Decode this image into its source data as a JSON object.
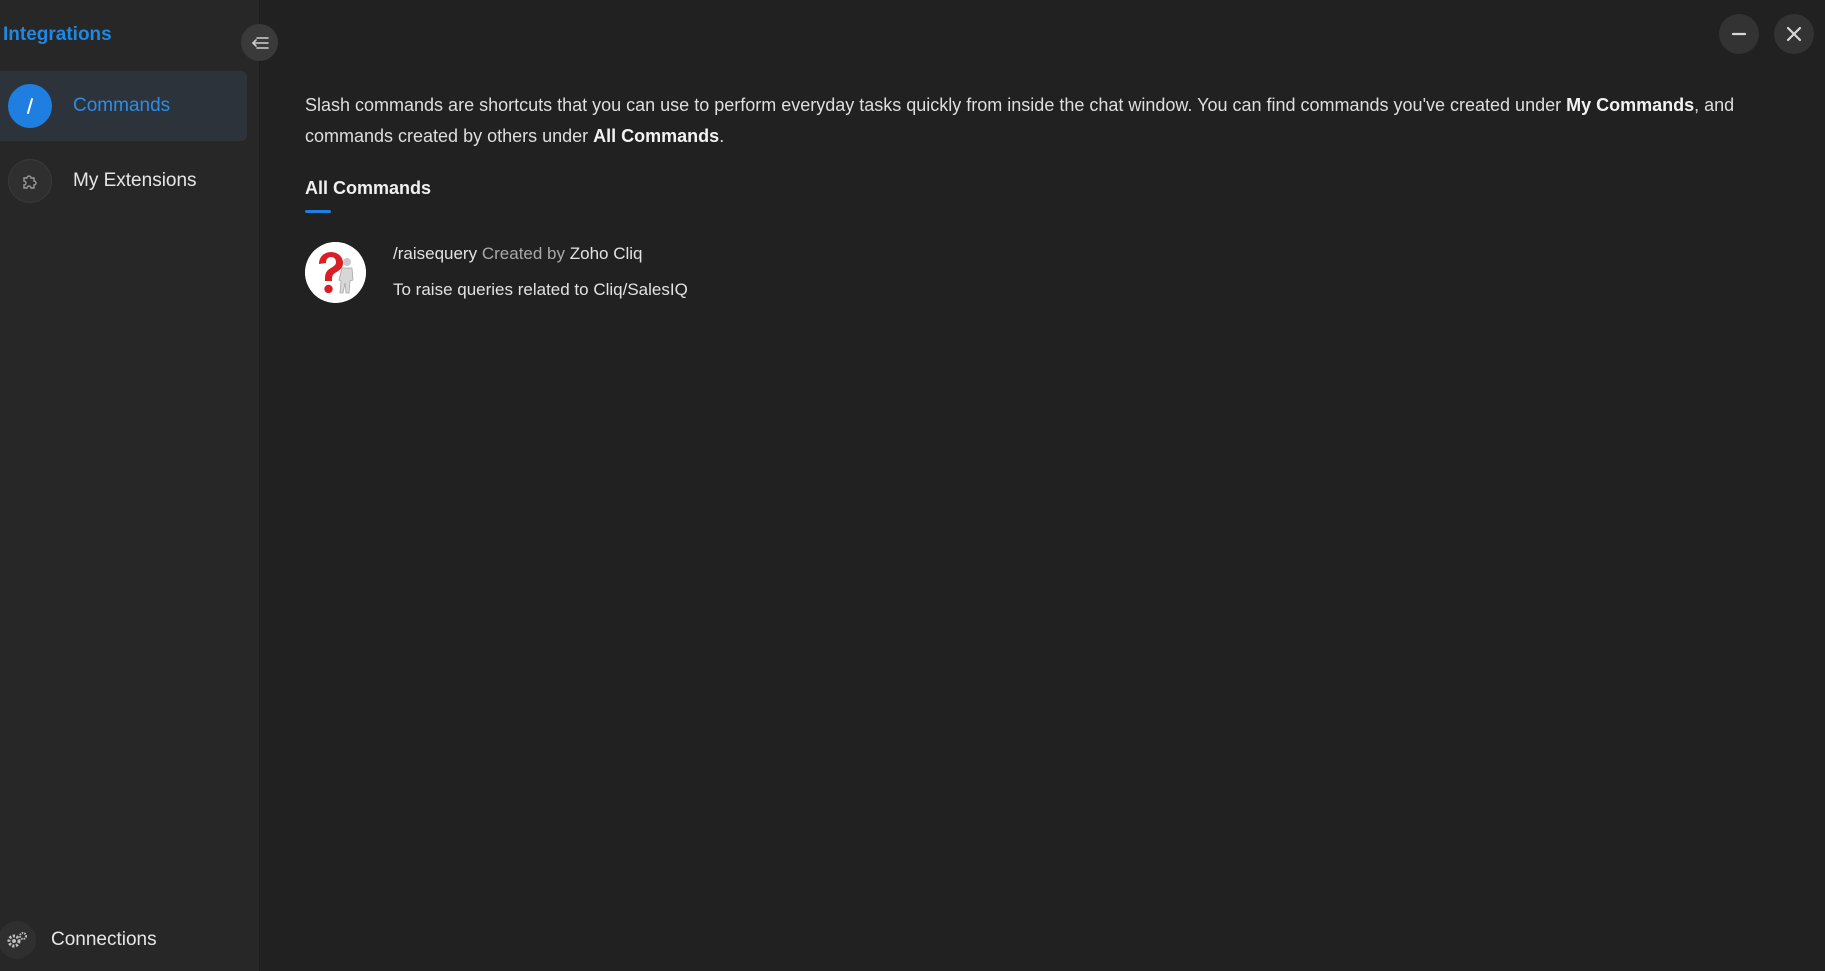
{
  "sidebar": {
    "title": "Integrations",
    "items": [
      {
        "label": "Commands",
        "icon": "slash-icon",
        "active": true
      },
      {
        "label": "My Extensions",
        "icon": "puzzle-icon",
        "active": false
      }
    ],
    "footer": {
      "label": "Connections",
      "icon": "gears-icon"
    }
  },
  "window_controls": {
    "minimize_icon": "minus-icon",
    "close_icon": "close-icon"
  },
  "main": {
    "intro": {
      "part1": "Slash commands are shortcuts that you can use to perform everyday tasks quickly from inside the chat window. You can find commands you've created under ",
      "bold1": "My Commands",
      "part2": ", and commands created by others under ",
      "bold2": "All Commands",
      "part3": "."
    },
    "section_title": "All Commands",
    "commands": [
      {
        "name": "/raisequery",
        "created_by_label": "Created by",
        "creator": "Zoho Cliq",
        "description": "To raise queries related to Cliq/SalesIQ",
        "icon": "question-mark-figure-icon"
      }
    ]
  },
  "colors": {
    "accent": "#1e7fe0",
    "background": "#212121",
    "sidebar": "#272727"
  }
}
